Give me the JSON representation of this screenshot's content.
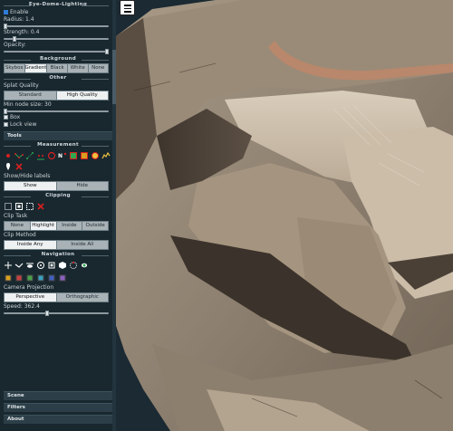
{
  "lighting": {
    "title": "Eye-Dome-Lighting",
    "enable_label": "Enable",
    "radius_label": "Radius: 1.4",
    "strength_label": "Strength: 0.4",
    "opacity_label": "Opacity:"
  },
  "background": {
    "title": "Background",
    "options": [
      "Skybox",
      "Gradient",
      "Black",
      "White",
      "None"
    ],
    "selected": "Gradient"
  },
  "other": {
    "title": "Other",
    "splat_label": "Splat Quality",
    "splat_options": [
      "Standard",
      "High Quality"
    ],
    "min_node_label": "Min node size: 30",
    "box_label": "Box",
    "lock_view_label": "Lock view"
  },
  "tools": {
    "label": "Tools"
  },
  "measurement": {
    "title": "Measurement",
    "show_hide_label": "Show/Hide labels",
    "show_label": "Show",
    "hide_label": "Hide"
  },
  "clipping": {
    "title": "Clipping",
    "task_label": "Clip Task",
    "task_options": [
      "None",
      "Highlight",
      "Inside",
      "Outside"
    ],
    "method_label": "Clip Method",
    "method_options": [
      "Inside Any",
      "Inside All"
    ]
  },
  "navigation": {
    "title": "Navigation",
    "projection_label": "Camera Projection",
    "projection_options": [
      "Perspective",
      "Orthographic"
    ],
    "speed_label": "Speed: 362.4"
  },
  "bottom_sections": {
    "scene": "Scene",
    "filters": "Filters",
    "about": "About"
  },
  "colors": {
    "sidebar_bg": "#19282f",
    "accent_red": "#d62020",
    "accent_green": "#2fa84f"
  }
}
